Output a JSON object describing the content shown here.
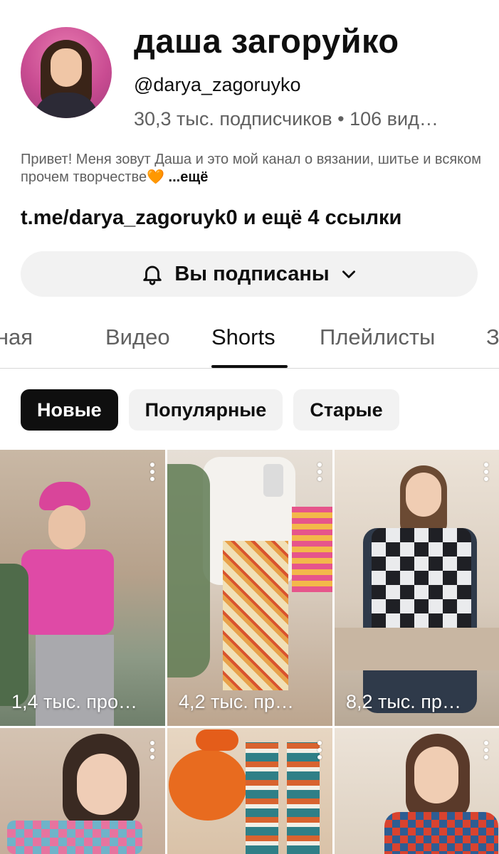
{
  "channel": {
    "name": "даша загоруйко",
    "handle": "@darya_zagoruyko",
    "stats": "30,3 тыс. подписчиков • 106 вид…"
  },
  "description": {
    "text": "Привет! Меня зовут Даша и это мой канал о вязании, шитье и всяком прочем творчестве",
    "emoji": "🧡",
    "more": " ...ещё"
  },
  "links": {
    "primary": "t.me/darya_zagoruyk0",
    "extra": " и ещё 4 ссылки"
  },
  "subscribe": {
    "label": "Вы подписаны"
  },
  "tabs": [
    {
      "label": "Главная"
    },
    {
      "label": "Видео"
    },
    {
      "label": "Shorts"
    },
    {
      "label": "Плейлисты"
    },
    {
      "label": "З"
    }
  ],
  "active_tab": "Shorts",
  "chips": [
    {
      "label": "Новые"
    },
    {
      "label": "Популярные"
    },
    {
      "label": "Старые"
    }
  ],
  "shorts": [
    {
      "views": "1,4 тыс. про…"
    },
    {
      "views": "4,2 тыс. пр…"
    },
    {
      "views": "8,2 тыс. пр…"
    },
    {
      "views": ""
    },
    {
      "views": ""
    },
    {
      "views": ""
    }
  ]
}
